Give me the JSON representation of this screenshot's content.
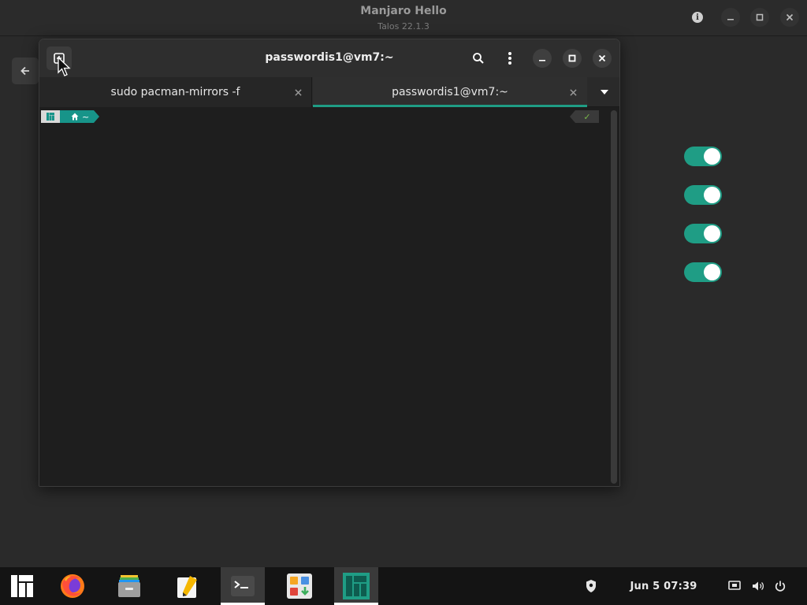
{
  "background_window": {
    "title": "Manjaro Hello",
    "subtitle": "Talos 22.1.3",
    "toggles": [
      {
        "name": "toggle-1",
        "state": "on"
      },
      {
        "name": "toggle-2",
        "state": "on"
      },
      {
        "name": "toggle-3",
        "state": "on"
      },
      {
        "name": "toggle-4",
        "state": "on"
      }
    ]
  },
  "terminal": {
    "title": "passwordis1@vm7:~",
    "tabs": [
      {
        "label": "sudo pacman-mirrors -f",
        "active": false
      },
      {
        "label": "passwordis1@vm7:~",
        "active": true
      }
    ],
    "prompt": {
      "home_symbol": "~",
      "status_symbol": "✓"
    }
  },
  "taskbar": {
    "apps": [
      {
        "icon": "manjaro-menu-icon"
      },
      {
        "icon": "firefox-icon"
      },
      {
        "icon": "file-manager-icon"
      },
      {
        "icon": "text-editor-icon"
      },
      {
        "icon": "terminal-icon",
        "active": true
      },
      {
        "icon": "software-center-icon"
      },
      {
        "icon": "manjaro-hello-icon",
        "active": true
      }
    ],
    "clock": "Jun 5  07:39"
  },
  "colors": {
    "accent": "#1f9d85",
    "prompt_teal": "#179489"
  }
}
